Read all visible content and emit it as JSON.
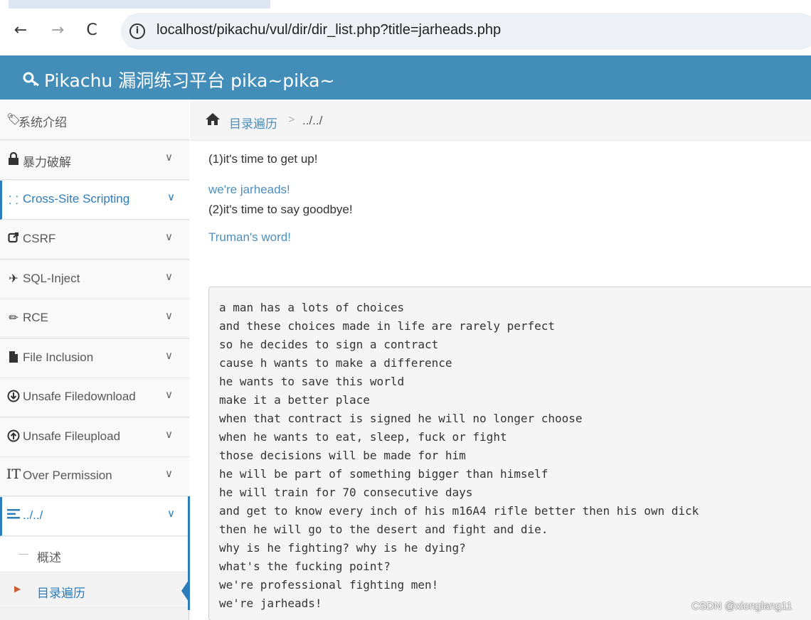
{
  "browser": {
    "url": "localhost/pikachu/vul/dir/dir_list.php?title=jarheads.php",
    "back_icon": "←",
    "forward_icon": "→",
    "reload_icon": "C",
    "info_icon": "i"
  },
  "app": {
    "title": "Pikachu 漏洞练习平台 pika~pika~",
    "header_color": "#438eb9"
  },
  "sidebar": {
    "items": [
      {
        "label": "系统介绍",
        "icon": "tags-icon"
      },
      {
        "label": "暴力破解",
        "icon": "lock-icon"
      },
      {
        "label": "Cross-Site Scripting",
        "icon": "list-icon"
      },
      {
        "label": "CSRF",
        "icon": "share-icon"
      },
      {
        "label": "SQL-Inject",
        "icon": "fighter-jet-icon"
      },
      {
        "label": "RCE",
        "icon": "pencil-icon"
      },
      {
        "label": "File Inclusion",
        "icon": "file-icon"
      },
      {
        "label": "Unsafe Filedownload",
        "icon": "download-icon"
      },
      {
        "label": "Unsafe Fileupload",
        "icon": "upload-icon"
      },
      {
        "label": "Over Permission",
        "icon": "text-icon"
      },
      {
        "label": "../../",
        "icon": "align-icon"
      }
    ],
    "subitems": [
      {
        "label": "概述"
      },
      {
        "label": "目录遍历"
      }
    ]
  },
  "breadcrumb": {
    "link": "目录遍历",
    "separator": ">",
    "current": "../../"
  },
  "content": {
    "line1": "(1)it's time to get up!",
    "link1": "we're jarheads!",
    "line2": "(2)it's time to say goodbye!",
    "link2": "Truman's word!",
    "poem": [
      "a man has a lots of choices",
      "and these choices made in life are rarely perfect",
      "so he decides to sign a contract",
      "cause h wants to make a difference",
      "he wants to save this world",
      "make it a better place",
      "when that contract is signed he will no longer choose",
      "when he wants to eat, sleep, fuck or fight",
      "those decisions will be made for him",
      "he will be part of something bigger than himself",
      "he will train for 70 consecutive days",
      "and get to know every inch of his m16A4 rifle better then his own dick",
      "then he will go to the desert and fight and die.",
      "why is he fighting? why is he dying?",
      "what's the fucking point?",
      "we're professional fighting men!",
      "we're jarheads!"
    ]
  },
  "watermark": "CSDN @xionglang11"
}
